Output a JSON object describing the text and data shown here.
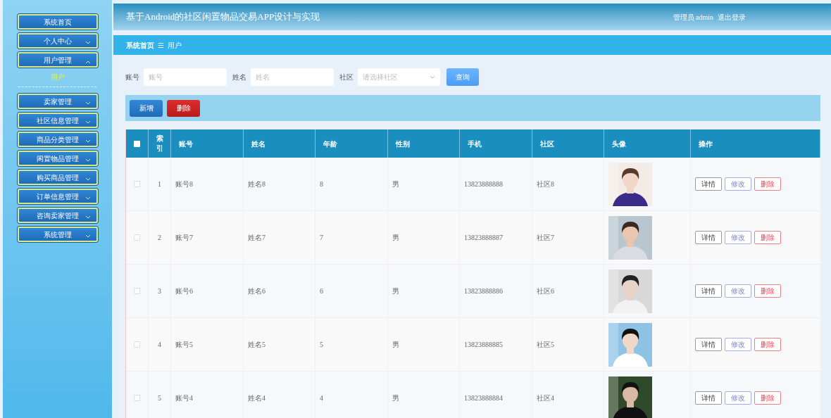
{
  "sidebar": {
    "items": [
      {
        "label": "系统首页",
        "kind": "link"
      },
      {
        "label": "个人中心",
        "kind": "menu",
        "expanded": false
      },
      {
        "label": "用户管理",
        "kind": "menu",
        "expanded": true,
        "children": [
          {
            "label": "用户"
          }
        ]
      },
      {
        "label": "卖家管理",
        "kind": "menu",
        "expanded": false
      },
      {
        "label": "社区信息管理",
        "kind": "menu",
        "expanded": false
      },
      {
        "label": "商品分类管理",
        "kind": "menu",
        "expanded": false
      },
      {
        "label": "闲置物品管理",
        "kind": "menu",
        "expanded": false
      },
      {
        "label": "购买商品管理",
        "kind": "menu",
        "expanded": false
      },
      {
        "label": "订单信息管理",
        "kind": "menu",
        "expanded": false
      },
      {
        "label": "咨询卖家管理",
        "kind": "menu",
        "expanded": false
      },
      {
        "label": "系统管理",
        "kind": "menu",
        "expanded": false
      }
    ]
  },
  "header": {
    "title": "基于Android的社区闲置物品交易APP设计与实现",
    "user": "管理员 admin",
    "logout": "退出登录"
  },
  "breadcrumb": {
    "items": [
      "系统首页",
      "用户"
    ],
    "separator": "☰"
  },
  "search": {
    "fields": [
      {
        "label": "账号",
        "placeholder": "账号",
        "kind": "input"
      },
      {
        "label": "姓名",
        "placeholder": "姓名",
        "kind": "input"
      },
      {
        "label": "社区",
        "placeholder": "请选择社区",
        "kind": "select"
      }
    ],
    "button": "查询"
  },
  "toolbar": {
    "buttons": [
      {
        "label": "新增",
        "kind": "primary"
      },
      {
        "label": "删除",
        "kind": "danger"
      }
    ]
  },
  "table": {
    "all_checked": false,
    "columns": [
      "索引",
      "账号",
      "姓名",
      "年龄",
      "性别",
      "手机",
      "社区",
      "头像",
      "操作"
    ],
    "rows": [
      {
        "checked": false,
        "index": "1",
        "account": "账号8",
        "name": "姓名8",
        "age": "8",
        "gender": "男",
        "phone": "13823888888",
        "community": "社区8",
        "actions": [
          "详情",
          "修改",
          "删除"
        ]
      },
      {
        "checked": false,
        "index": "2",
        "account": "账号7",
        "name": "姓名7",
        "age": "7",
        "gender": "男",
        "phone": "13823888887",
        "community": "社区7",
        "actions": [
          "详情",
          "修改",
          "删除"
        ]
      },
      {
        "checked": false,
        "index": "3",
        "account": "账号6",
        "name": "姓名6",
        "age": "6",
        "gender": "男",
        "phone": "13823888886",
        "community": "社区6",
        "actions": [
          "详情",
          "修改",
          "删除"
        ]
      },
      {
        "checked": false,
        "index": "4",
        "account": "账号5",
        "name": "姓名5",
        "age": "5",
        "gender": "男",
        "phone": "13823888885",
        "community": "社区5",
        "actions": [
          "详情",
          "修改",
          "删除"
        ]
      },
      {
        "checked": false,
        "index": "5",
        "account": "账号4",
        "name": "姓名4",
        "age": "4",
        "gender": "男",
        "phone": "13823888884",
        "community": "社区4",
        "actions": [
          "详情",
          "修改",
          "删除"
        ]
      }
    ]
  }
}
